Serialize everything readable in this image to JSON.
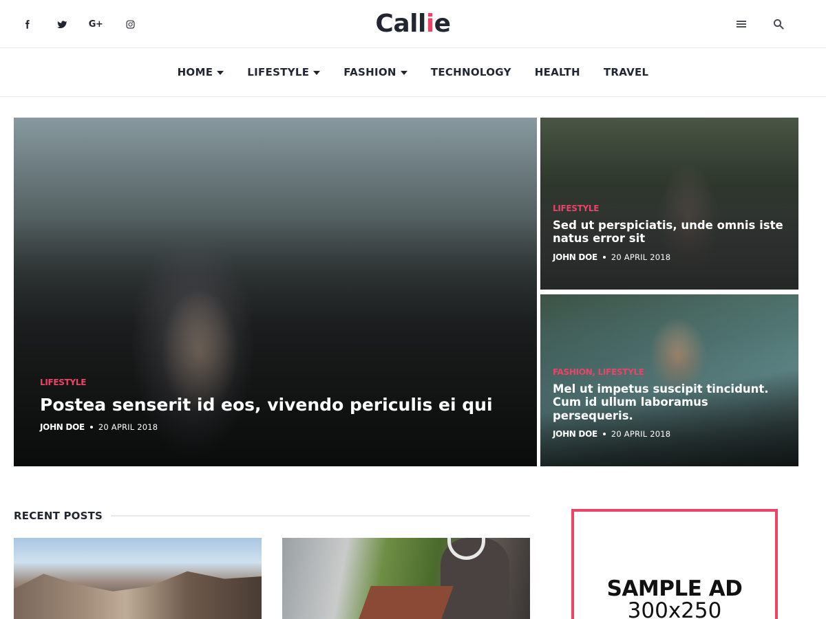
{
  "header": {
    "social": [
      {
        "icon": "facebook-icon"
      },
      {
        "icon": "twitter-icon"
      },
      {
        "icon": "google-plus-icon",
        "glyph": "G+"
      },
      {
        "icon": "instagram-icon"
      }
    ],
    "logo": {
      "part1": "Call",
      "part2": "i",
      "part3": "e"
    },
    "right_icons": [
      "menu-icon",
      "search-icon"
    ]
  },
  "nav": {
    "items": [
      {
        "label": "HOME",
        "dropdown": true
      },
      {
        "label": "LIFESTYLE",
        "dropdown": true
      },
      {
        "label": "FASHION",
        "dropdown": true
      },
      {
        "label": "TECHNOLOGY",
        "dropdown": false
      },
      {
        "label": "HEALTH",
        "dropdown": false
      },
      {
        "label": "TRAVEL",
        "dropdown": false
      }
    ]
  },
  "hero": {
    "main": {
      "category": "LIFESTYLE",
      "title": "Postea senserit id eos, vivendo periculis ei qui",
      "author": "JOHN DOE",
      "date": "20 APRIL 2018"
    },
    "side_a": {
      "category": "LIFESTYLE",
      "title": "Sed ut perspiciatis, unde omnis iste natus error sit",
      "author": "JOHN DOE",
      "date": "20 APRIL 2018"
    },
    "side_b": {
      "category": "FASHION, LIFESTYLE",
      "title": "Mel ut impetus suscipit tincidunt. Cum id ullum laboramus persequeris.",
      "author": "JOHN DOE",
      "date": "20 APRIL 2018"
    }
  },
  "recent": {
    "title": "RECENT POSTS"
  },
  "ad": {
    "line1": "SAMPLE AD",
    "line2": "300x250"
  },
  "colors": {
    "accent": "#ee4266",
    "text": "#212631",
    "border": "#e8eaed"
  }
}
